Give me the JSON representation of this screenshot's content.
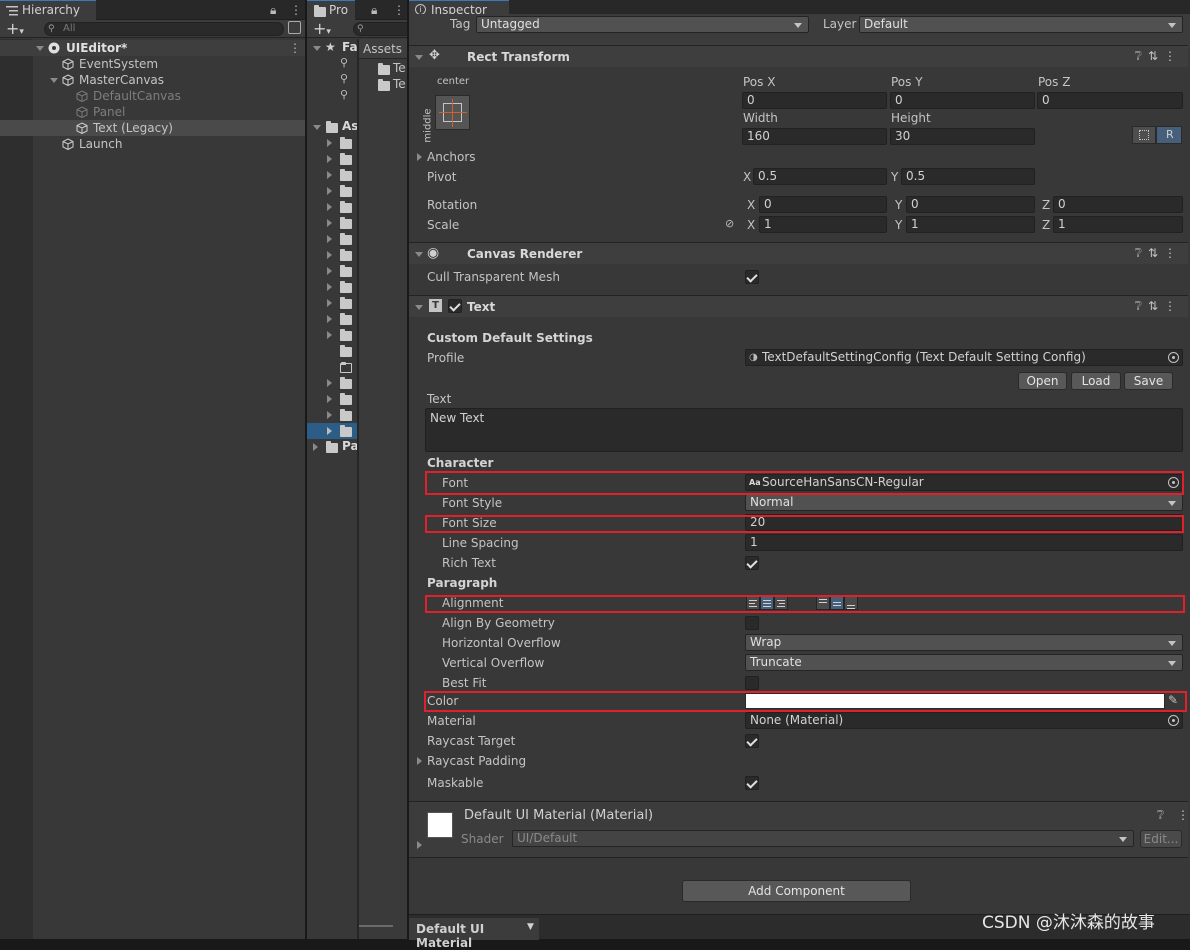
{
  "hierarchy": {
    "tab_label": "Hierarchy",
    "search_placeholder": "All",
    "scene_name": "UIEditor*",
    "items": [
      {
        "label": "EventSystem"
      },
      {
        "label": "MasterCanvas"
      },
      {
        "label": "DefaultCanvas"
      },
      {
        "label": "Panel"
      },
      {
        "label": "Text (Legacy)"
      },
      {
        "label": "Launch"
      }
    ]
  },
  "project": {
    "tab_label": "Pro",
    "favorites_label": "Fa",
    "assets_label": "As",
    "packages_label": "Pa",
    "breadcrumb": "Assets",
    "right_items": [
      "Te",
      "Te"
    ]
  },
  "inspector": {
    "tab_label": "Inspector",
    "tag_label": "Tag",
    "tag_value": "Untagged",
    "layer_label": "Layer",
    "layer_value": "Default",
    "rect_transform": {
      "title": "Rect Transform",
      "anchor_h": "center",
      "anchor_v": "middle",
      "pos_x_label": "Pos X",
      "pos_y_label": "Pos Y",
      "pos_z_label": "Pos Z",
      "pos_x": "0",
      "pos_y": "0",
      "pos_z": "0",
      "width_label": "Width",
      "height_label": "Height",
      "width": "160",
      "height": "30",
      "r_button": "R",
      "anchors_label": "Anchors",
      "pivot_label": "Pivot",
      "pivot_x": "0.5",
      "pivot_y": "0.5",
      "rotation_label": "Rotation",
      "rot_x": "0",
      "rot_y": "0",
      "rot_z": "0",
      "scale_label": "Scale",
      "scale_x": "1",
      "scale_y": "1",
      "scale_z": "1",
      "x": "X",
      "y": "Y",
      "z": "Z"
    },
    "canvas_renderer": {
      "title": "Canvas Renderer",
      "cull_label": "Cull Transparent Mesh",
      "cull_checked": true
    },
    "text": {
      "title": "Text",
      "custom_settings_label": "Custom Default Settings",
      "profile_label": "Profile",
      "profile_value": "TextDefaultSettingConfig (Text Default Setting Config)",
      "open_button": "Open",
      "load_button": "Load",
      "save_button": "Save",
      "text_label": "Text",
      "text_value": "New Text",
      "character_label": "Character",
      "font_label": "Font",
      "font_value": "SourceHanSansCN-Regular",
      "font_icon": "Aa",
      "font_style_label": "Font Style",
      "font_style_value": "Normal",
      "font_size_label": "Font Size",
      "font_size_value": "20",
      "line_spacing_label": "Line Spacing",
      "line_spacing_value": "1",
      "rich_text_label": "Rich Text",
      "paragraph_label": "Paragraph",
      "alignment_label": "Alignment",
      "align_by_geometry_label": "Align By Geometry",
      "horizontal_overflow_label": "Horizontal Overflow",
      "horizontal_overflow_value": "Wrap",
      "vertical_overflow_label": "Vertical Overflow",
      "vertical_overflow_value": "Truncate",
      "best_fit_label": "Best Fit",
      "color_label": "Color",
      "color_value": "#ffffff",
      "material_label": "Material",
      "material_value": "None (Material)",
      "raycast_target_label": "Raycast Target",
      "raycast_padding_label": "Raycast Padding",
      "maskable_label": "Maskable"
    },
    "material": {
      "title": "Default UI Material (Material)",
      "shader_label": "Shader",
      "shader_value": "UI/Default",
      "edit_button": "Edit..."
    },
    "add_component_button": "Add Component",
    "bottom_tab": "Default UI Material"
  },
  "watermark": "CSDN @沐沐森的故事",
  "colors": {
    "highlight": "#e0202a",
    "selection": "#2c5d87",
    "panel_bg": "#383838"
  }
}
